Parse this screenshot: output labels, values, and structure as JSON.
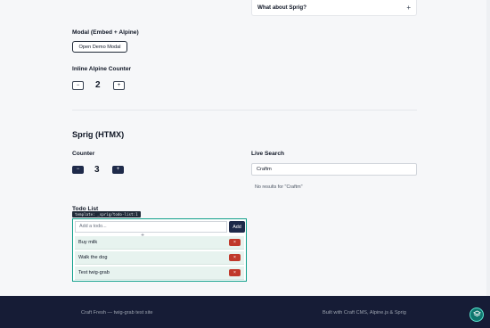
{
  "accordion": {
    "title": "What about Sprig?",
    "toggle": "+"
  },
  "modal": {
    "heading": "Modal (Embed + Alpine)",
    "button_label": "Open Demo Modal"
  },
  "alpine_counter": {
    "heading": "Inline Alpine Counter",
    "decrement": "−",
    "value": "2",
    "increment": "+"
  },
  "sprig": {
    "heading": "Sprig (HTMX)"
  },
  "sprig_counter": {
    "heading": "Counter",
    "decrement": "−",
    "value": "3",
    "increment": "+"
  },
  "live_search": {
    "heading": "Live Search",
    "query": "Craftm",
    "no_results": "No results for \"Craftm\""
  },
  "todo": {
    "heading": "Todo List",
    "template_tag": "template: _sprig/todo-list:1",
    "placeholder": "Add a todo...",
    "add_label": "Add",
    "move_icon": "+",
    "delete_label": "×",
    "items": [
      "Buy milk",
      "Walk the dog",
      "Test twig-grab"
    ]
  },
  "footer": {
    "left": "Craft Fresh — twig-grab test site",
    "right": "Built with Craft CMS, Alpine.js & Sprig"
  },
  "colors": {
    "accent": "#1e2a4a",
    "teal": "#0f9f8a",
    "danger": "#c0392b",
    "footer_bg": "#161c36"
  }
}
